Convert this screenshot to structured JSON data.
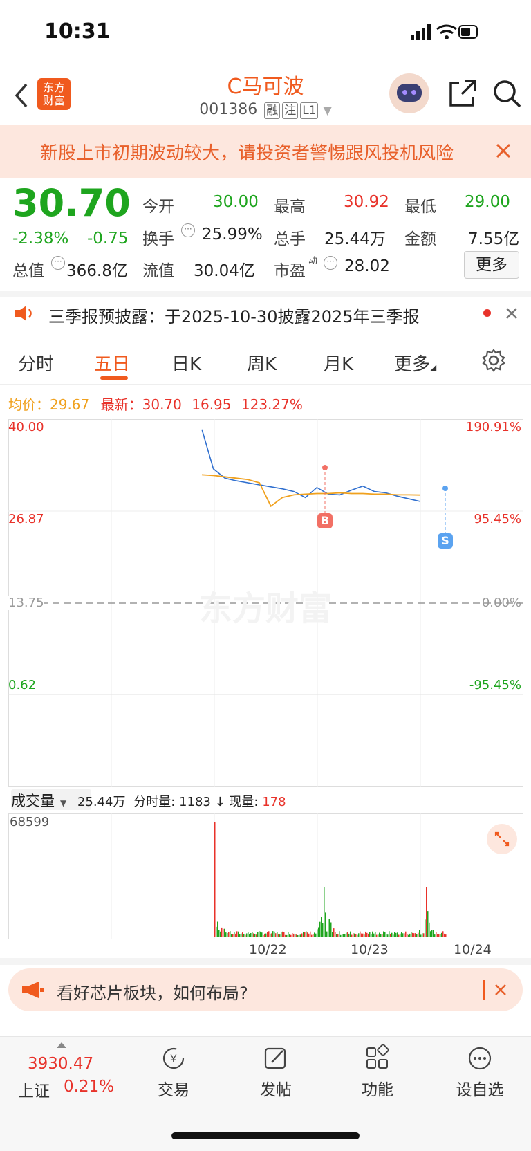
{
  "status_bar": {
    "time": "10:31"
  },
  "header": {
    "title": "C马可波",
    "code": "001386",
    "tags": [
      "融",
      "注",
      "L1"
    ]
  },
  "warning": {
    "text": "新股上市初期波动较大，请投资者警惕跟风投机风险"
  },
  "quote": {
    "price": "30.70",
    "change_pct": "-2.38%",
    "change": "-0.75",
    "open_label": "今开",
    "open": "30.00",
    "high_label": "最高",
    "high": "30.92",
    "low_label": "最低",
    "low": "29.00",
    "turnover_label": "换手",
    "turnover": "25.99%",
    "volume_label": "总手",
    "volume": "25.44万",
    "amount_label": "金额",
    "amount": "7.55亿",
    "mktcap_label": "总值",
    "mktcap": "366.8亿",
    "float_label": "流值",
    "float": "30.04亿",
    "pe_label": "市盈",
    "pe_sup": "动",
    "pe": "28.02",
    "more": "更多"
  },
  "notice": {
    "text": "三季报预披露：于2025-10-30披露2025年三季报"
  },
  "tabs": [
    "分时",
    "五日",
    "日K",
    "周K",
    "月K",
    "更多"
  ],
  "active_tab": 1,
  "chart_info": {
    "avg_label": "均价：",
    "avg": "29.67",
    "latest_label": "最新：",
    "latest": "30.70",
    "change": "16.95",
    "change_pct": "123.27%"
  },
  "chart_data": {
    "type": "line",
    "y_left_ticks": [
      "40.00",
      "26.87",
      "13.75",
      "0.62"
    ],
    "y_right_ticks": [
      "190.91%",
      "95.45%",
      "0.00%",
      "-95.45%"
    ],
    "x_ticks": [
      "10/22",
      "10/23",
      "10/24"
    ],
    "ylim": [
      0.62,
      40.0
    ],
    "markers": [
      "B",
      "S"
    ],
    "series": [
      {
        "values": [
          39.5,
          33.6,
          32.2,
          31.8,
          31.5,
          31.2,
          30.9,
          30.6,
          30.2,
          29.3,
          30.8,
          29.8,
          29.7,
          30.4,
          31.0,
          30.2,
          30.0,
          29.5,
          29.1,
          28.7
        ]
      },
      {
        "values": [
          32.7,
          32.6,
          32.4,
          32.2,
          32.0,
          31.5,
          28.0,
          29.3,
          29.7,
          29.8,
          29.9,
          29.9,
          30.0,
          29.9,
          29.9,
          29.8,
          29.8,
          29.7,
          29.7,
          29.67
        ]
      }
    ]
  },
  "volume": {
    "selector": "成交量",
    "total": "25.44万",
    "min_label": "分时量:",
    "min_vol": "1183",
    "now_label": "现量:",
    "now_vol": "178",
    "max_tick": "68599"
  },
  "ad": {
    "text": "看好芯片板块，如何布局?"
  },
  "bottom_nav": {
    "index_value": "3930.47",
    "index_name": "上证",
    "index_pct": "0.21%",
    "items": [
      "交易",
      "发帖",
      "功能",
      "设自选"
    ]
  },
  "colors": {
    "up": "#e8322a",
    "down": "#1ea51e",
    "accent": "#f05a1e",
    "avg": "#f0a11e"
  }
}
